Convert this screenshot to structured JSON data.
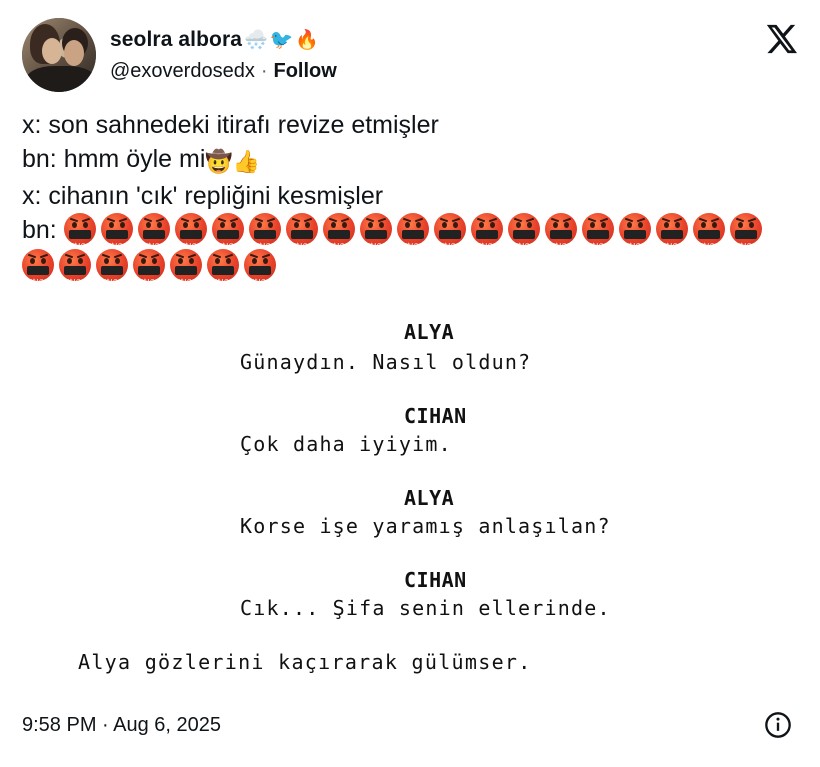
{
  "author": {
    "name": "seolra albora",
    "name_emojis": [
      "🌨️",
      "🐦",
      "🔥"
    ],
    "handle": "@exoverdosedx",
    "separator": "·",
    "follow_label": "Follow"
  },
  "tweet": {
    "lines": [
      "x: son sahnedeki itirafı revize etmişler",
      "bn: hmm öyle mi",
      "x: cihanın 'cık' repliğini kesmişler",
      "bn:"
    ],
    "line2_emojis": [
      "🤠",
      "👍"
    ],
    "angry_emoji": "🤬",
    "angry_count_row1": 19,
    "angry_count_row2": 7
  },
  "screenplay": {
    "char1": "ALYA",
    "line1": "Günaydın. Nasıl oldun?",
    "char2": "CIHAN",
    "line2": "Çok daha iyiyim.",
    "char3": "ALYA",
    "line3": "Korse işe yaramış anlaşılan?",
    "char4": "CIHAN",
    "line4": "Cık... Şifa senin ellerinde.",
    "action": "Alya gözlerini kaçırarak gülümser."
  },
  "footer": {
    "timestamp": "9:58 PM · Aug 6, 2025"
  },
  "icons": {
    "platform_logo": "x-logo-icon",
    "info": "info-icon"
  }
}
